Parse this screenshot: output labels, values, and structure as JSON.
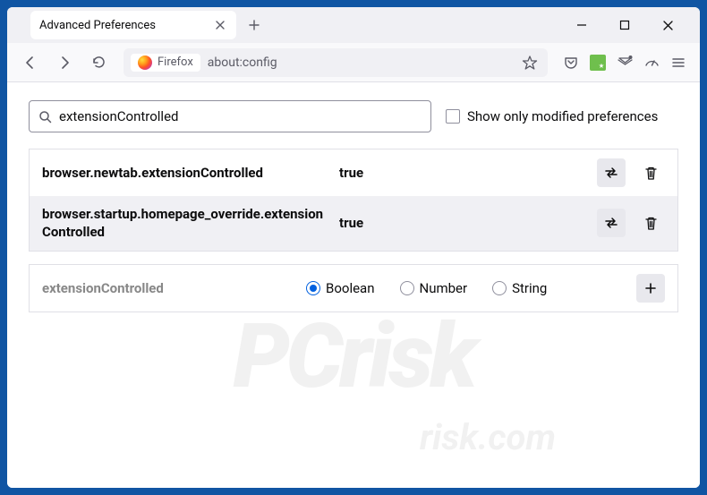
{
  "tab": {
    "title": "Advanced Preferences"
  },
  "urlbar": {
    "identity": "Firefox",
    "url": "about:config"
  },
  "search": {
    "value": "extensionControlled",
    "checkbox_label": "Show only modified preferences"
  },
  "prefs": [
    {
      "name": "browser.newtab.extensionControlled",
      "value": "true"
    },
    {
      "name": "browser.startup.homepage_override.extensionControlled",
      "value": "true"
    }
  ],
  "add": {
    "name": "extensionControlled",
    "types": [
      "Boolean",
      "Number",
      "String"
    ],
    "selected": "Boolean"
  },
  "watermark": {
    "main": "PCrisk",
    "sub": "risk.com"
  }
}
